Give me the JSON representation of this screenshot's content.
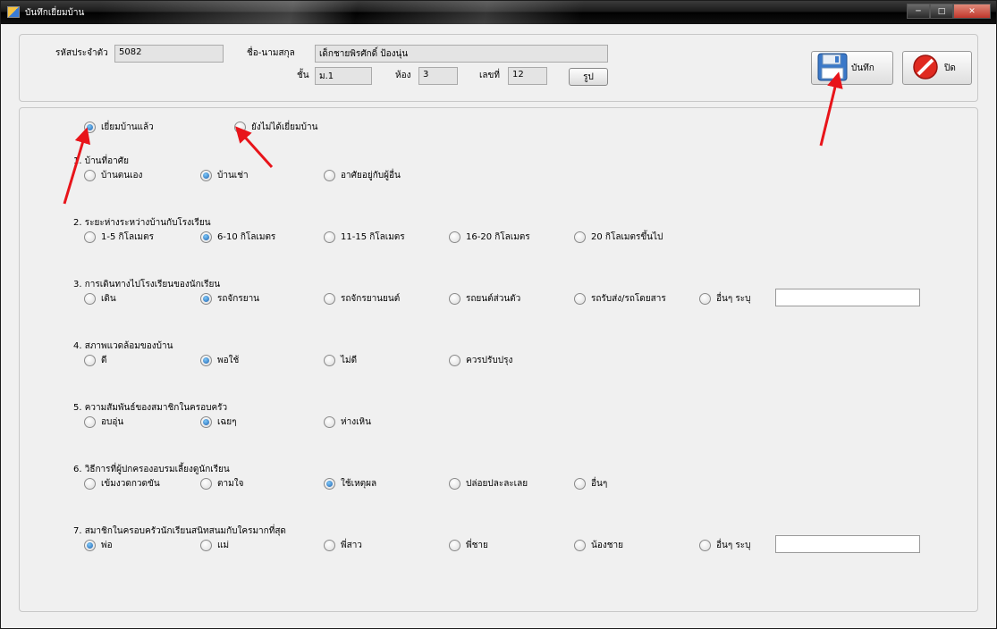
{
  "window": {
    "title": "บันทึกเยี่ยมบ้าน"
  },
  "student": {
    "id_label": "รหัสประจำตัว",
    "id_value": "5082",
    "name_label": "ชื่อ-นามสกุล",
    "name_value": "เด็กชายพิรศักดิ์ ป้องนุ่น",
    "grade_label": "ชั้น",
    "grade_value": "ม.1",
    "room_label": "ห้อง",
    "room_value": "3",
    "number_label": "เลขที่",
    "number_value": "12",
    "photo_button": "รูป"
  },
  "toolbar": {
    "save_label": "บันทึก",
    "close_label": "ปิด"
  },
  "visit_status": {
    "visited": "เยี่ยมบ้านแล้ว",
    "not_visited": "ยังไม่ได้เยี่ยมบ้าน",
    "selected": "visited"
  },
  "questions": [
    {
      "title": "1. บ้านที่อาศัย",
      "options": [
        "บ้านตนเอง",
        "บ้านเช่า",
        "อาศัยอยู่กับผู้อื่น"
      ],
      "selected": 1
    },
    {
      "title": "2. ระยะห่างระหว่างบ้านกับโรงเรียน",
      "options": [
        "1-5 กิโลเมตร",
        "6-10 กิโลเมตร",
        "11-15 กิโลเมตร",
        "16-20 กิโลเมตร",
        "20 กิโลเมตรขึ้นไป"
      ],
      "selected": 1
    },
    {
      "title": "3. การเดินทางไปโรงเรียนของนักเรียน",
      "options": [
        "เดิน",
        "รถจักรยาน",
        "รถจักรยานยนต์",
        "รถยนต์ส่วนตัว",
        "รถรับส่ง/รถโดยสาร",
        "อื่นๆ ระบุ"
      ],
      "selected": 1
    },
    {
      "title": "4. สภาพแวดล้อมของบ้าน",
      "options": [
        "ดี",
        "พอใช้",
        "ไม่ดี",
        "ควรปรับปรุง"
      ],
      "selected": 1
    },
    {
      "title": "5. ความสัมพันธ์ของสมาชิกในครอบครัว",
      "options": [
        "อบอุ่น",
        "เฉยๆ",
        "ห่างเหิน"
      ],
      "selected": 1
    },
    {
      "title": "6. วิธีการที่ผู้ปกครองอบรมเลี้ยงดูนักเรียน",
      "options": [
        "เข้มงวดกวดขัน",
        "ตามใจ",
        "ใช้เหตุผล",
        "ปล่อยปละละเลย",
        "อื่นๆ"
      ],
      "selected": 2
    },
    {
      "title": "7. สมาชิกในครอบครัวนักเรียนสนิทสนมกับใครมากที่สุด",
      "options": [
        "พ่อ",
        "แม่",
        "พี่สาว",
        "พี่ชาย",
        "น้องชาย",
        "อื่นๆ ระบุ"
      ],
      "selected": 0
    }
  ],
  "colors": {
    "accent_arrow": "#e8141a",
    "radio_selected": "#1e62b0"
  },
  "icons": {
    "save": "floppy-disk-icon",
    "close": "no-entry-icon"
  }
}
